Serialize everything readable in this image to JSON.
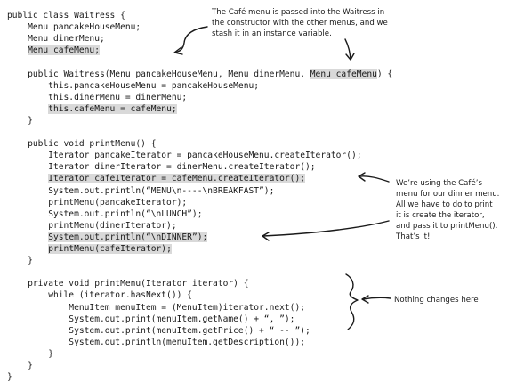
{
  "code": {
    "lines": [
      {
        "segments": [
          {
            "text": "public class Waitress {"
          }
        ]
      },
      {
        "segments": [
          {
            "text": "    Menu pancakeHouseMenu;"
          }
        ]
      },
      {
        "segments": [
          {
            "text": "    Menu dinerMenu;"
          }
        ]
      },
      {
        "segments": [
          {
            "text": "    "
          },
          {
            "text": "Menu cafeMenu;",
            "hl": true
          }
        ]
      },
      {
        "segments": [
          {
            "text": ""
          }
        ]
      },
      {
        "segments": [
          {
            "text": "    public Waitress(Menu pancakeHouseMenu, Menu dinerMenu, "
          },
          {
            "text": "Menu cafeMenu",
            "hl": true
          },
          {
            "text": ") {"
          }
        ]
      },
      {
        "segments": [
          {
            "text": "        this.pancakeHouseMenu = pancakeHouseMenu;"
          }
        ]
      },
      {
        "segments": [
          {
            "text": "        this.dinerMenu = dinerMenu;"
          }
        ]
      },
      {
        "segments": [
          {
            "text": "        "
          },
          {
            "text": "this.cafeMenu = cafeMenu;",
            "hl": true
          }
        ]
      },
      {
        "segments": [
          {
            "text": "    }"
          }
        ]
      },
      {
        "segments": [
          {
            "text": ""
          }
        ]
      },
      {
        "segments": [
          {
            "text": "    public void printMenu() {"
          }
        ]
      },
      {
        "segments": [
          {
            "text": "        Iterator pancakeIterator = pancakeHouseMenu.createIterator();"
          }
        ]
      },
      {
        "segments": [
          {
            "text": "        Iterator dinerIterator = dinerMenu.createIterator();"
          }
        ]
      },
      {
        "segments": [
          {
            "text": "        "
          },
          {
            "text": "Iterator cafeIterator = cafeMenu.createIterator();",
            "hl": true
          }
        ]
      },
      {
        "segments": [
          {
            "text": "        System.out.println(“MENU\\n----\\nBREAKFAST”);"
          }
        ]
      },
      {
        "segments": [
          {
            "text": "        printMenu(pancakeIterator);"
          }
        ]
      },
      {
        "segments": [
          {
            "text": "        System.out.println(“\\nLUNCH”);"
          }
        ]
      },
      {
        "segments": [
          {
            "text": "        printMenu(dinerIterator);"
          }
        ]
      },
      {
        "segments": [
          {
            "text": "        "
          },
          {
            "text": "System.out.println(“\\nDINNER”);",
            "hl": true
          }
        ]
      },
      {
        "segments": [
          {
            "text": "        "
          },
          {
            "text": "printMenu(cafeIterator);",
            "hl": true
          }
        ]
      },
      {
        "segments": [
          {
            "text": "    }"
          }
        ]
      },
      {
        "segments": [
          {
            "text": ""
          }
        ]
      },
      {
        "segments": [
          {
            "text": "    private void printMenu(Iterator iterator) {"
          }
        ]
      },
      {
        "segments": [
          {
            "text": "        while (iterator.hasNext()) {"
          }
        ]
      },
      {
        "segments": [
          {
            "text": "            MenuItem menuItem = (MenuItem)iterator.next();"
          }
        ]
      },
      {
        "segments": [
          {
            "text": "            System.out.print(menuItem.getName() + “, ”);"
          }
        ]
      },
      {
        "segments": [
          {
            "text": "            System.out.print(menuItem.getPrice() + “ -- ”);"
          }
        ]
      },
      {
        "segments": [
          {
            "text": "            System.out.println(menuItem.getDescription());"
          }
        ]
      },
      {
        "segments": [
          {
            "text": "        }"
          }
        ]
      },
      {
        "segments": [
          {
            "text": "    }"
          }
        ]
      },
      {
        "segments": [
          {
            "text": "}"
          }
        ]
      }
    ]
  },
  "annotations": {
    "cafe_menu_note": "The Café menu is passed into the Waitress in\nthe constructor with the other menus, and we\nstash it in an instance variable.",
    "dinner_menu_note": "We’re using the Café’s\nmenu for our dinner menu.\nAll we have to do to print\nit is create the iterator,\nand pass it to printMenu().\nThat’s it!",
    "nothing_changes_note": "Nothing changes here"
  },
  "colors": {
    "highlight": "#d9d9d9",
    "ink": "#1a1a1a"
  }
}
